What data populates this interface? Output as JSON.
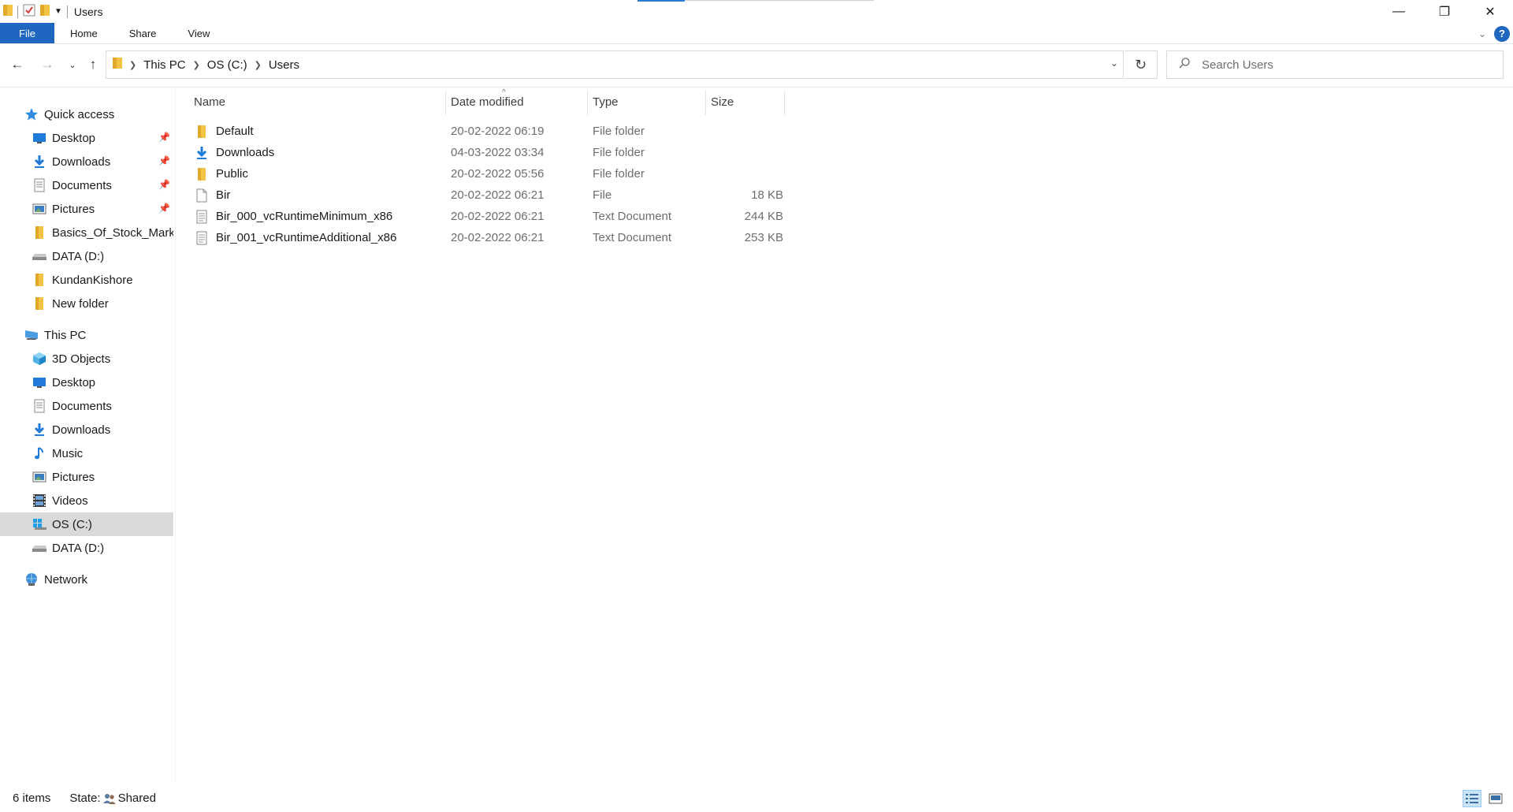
{
  "window": {
    "title": "Users",
    "minimize_glyph": "—",
    "maximize_glyph": "❐",
    "close_glyph": "✕"
  },
  "ribbon": {
    "tabs": [
      {
        "label": "File"
      },
      {
        "label": "Home"
      },
      {
        "label": "Share"
      },
      {
        "label": "View"
      }
    ],
    "help_label": "?"
  },
  "address": {
    "crumbs": [
      "This PC",
      "OS (C:)",
      "Users"
    ]
  },
  "search": {
    "placeholder": "Search Users"
  },
  "sidebar": {
    "quick_access": {
      "label": "Quick access",
      "items": [
        {
          "label": "Desktop",
          "icon": "desktop-icon",
          "pinned": true
        },
        {
          "label": "Downloads",
          "icon": "downloads-icon",
          "pinned": true
        },
        {
          "label": "Documents",
          "icon": "documents-icon",
          "pinned": true
        },
        {
          "label": "Pictures",
          "icon": "pictures-icon",
          "pinned": true
        },
        {
          "label": "Basics_Of_Stock_Market",
          "icon": "folder-icon",
          "pinned": false
        },
        {
          "label": "DATA (D:)",
          "icon": "drive-icon",
          "pinned": false
        },
        {
          "label": "KundanKishore",
          "icon": "folder-icon",
          "pinned": false
        },
        {
          "label": "New folder",
          "icon": "folder-icon",
          "pinned": false
        }
      ]
    },
    "this_pc": {
      "label": "This PC",
      "items": [
        {
          "label": "3D Objects",
          "icon": "3d-objects-icon"
        },
        {
          "label": "Desktop",
          "icon": "desktop-icon"
        },
        {
          "label": "Documents",
          "icon": "documents-icon"
        },
        {
          "label": "Downloads",
          "icon": "downloads-icon"
        },
        {
          "label": "Music",
          "icon": "music-icon"
        },
        {
          "label": "Pictures",
          "icon": "pictures-icon"
        },
        {
          "label": "Videos",
          "icon": "videos-icon"
        },
        {
          "label": "OS (C:)",
          "icon": "windows-drive-icon",
          "selected": true
        },
        {
          "label": "DATA (D:)",
          "icon": "drive-icon"
        }
      ]
    },
    "network": {
      "label": "Network"
    }
  },
  "file_list": {
    "columns": {
      "name": "Name",
      "date": "Date modified",
      "type": "Type",
      "size": "Size"
    },
    "rows": [
      {
        "name": "Default",
        "date": "20-02-2022 06:19",
        "type": "File folder",
        "size": "",
        "icon": "folder-icon"
      },
      {
        "name": "Downloads",
        "date": "04-03-2022 03:34",
        "type": "File folder",
        "size": "",
        "icon": "downloads-icon"
      },
      {
        "name": "Public",
        "date": "20-02-2022 05:56",
        "type": "File folder",
        "size": "",
        "icon": "folder-icon"
      },
      {
        "name": "Bir",
        "date": "20-02-2022 06:21",
        "type": "File",
        "size": "18 KB",
        "icon": "file-icon"
      },
      {
        "name": "Bir_000_vcRuntimeMinimum_x86",
        "date": "20-02-2022 06:21",
        "type": "Text Document",
        "size": "244 KB",
        "icon": "text-document-icon"
      },
      {
        "name": "Bir_001_vcRuntimeAdditional_x86",
        "date": "20-02-2022 06:21",
        "type": "Text Document",
        "size": "253 KB",
        "icon": "text-document-icon"
      }
    ]
  },
  "status": {
    "item_count": "6 items",
    "state_label": "State:",
    "state_value": "Shared"
  },
  "colors": {
    "accent": "#1f66c1",
    "folder": "#f3c443",
    "selected_bg": "#d9d9d9"
  }
}
